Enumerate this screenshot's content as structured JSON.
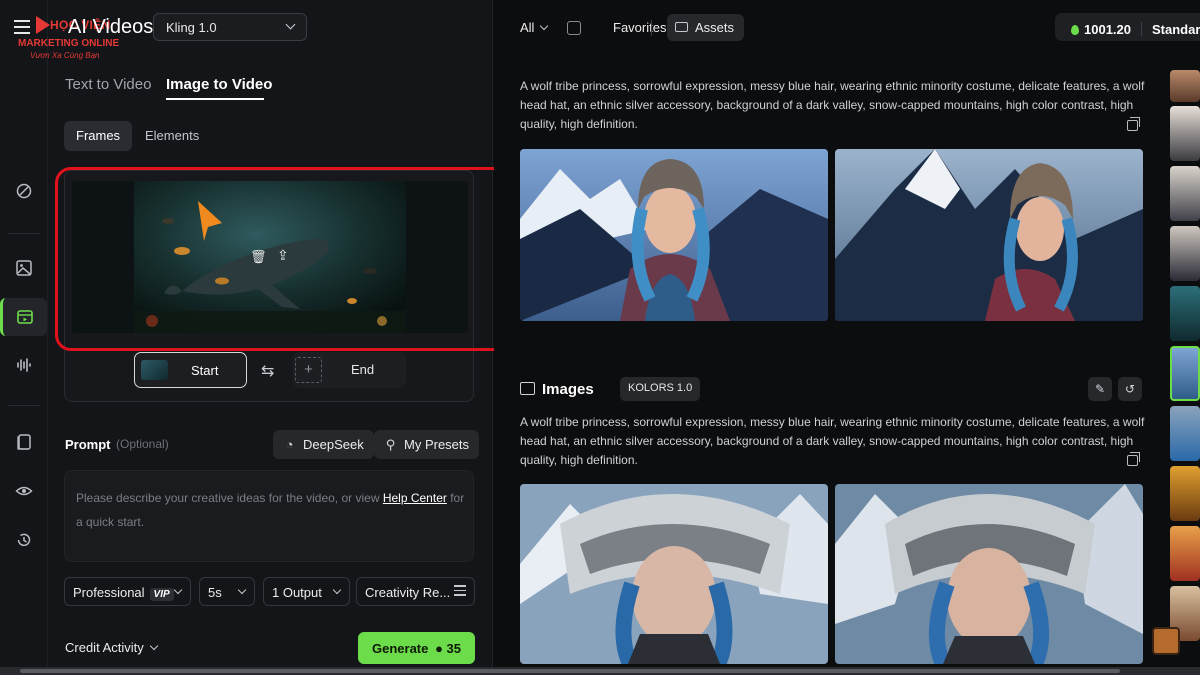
{
  "logo": {
    "brand": "HỌC VIỆN",
    "line1": "MARKETING ONLINE",
    "line2": "Vươn Xa Cùng Bạn"
  },
  "header": {
    "title": "AI Videos",
    "model": "Kling 1.0"
  },
  "mode_tabs": [
    "Text to Video",
    "Image to Video"
  ],
  "sub_tabs": [
    "Frames",
    "Elements"
  ],
  "frames": {
    "start_label": "Start",
    "end_label": "End",
    "swap_glyph": "⇆",
    "add_glyph": "+"
  },
  "prompt": {
    "label": "Prompt",
    "optional": "(Optional)",
    "deepseek": "DeepSeek",
    "presets": "My Presets",
    "placeholder_before": "Please describe your creative ideas for the video, or view ",
    "help_link": "Help Center",
    "placeholder_after": " for a quick start."
  },
  "options": {
    "mode": "Professional",
    "vip": "VIP",
    "duration": "5s",
    "outputs": "1 Output",
    "creativity": "Creativity Re..."
  },
  "footer": {
    "credit_activity": "Credit Activity",
    "generate": "Generate",
    "cost": "35"
  },
  "topbar": {
    "filter": "All",
    "favorites": "Favorites",
    "assets": "Assets",
    "credits": "1001.20",
    "plan": "Standard"
  },
  "results": [
    {
      "prompt": "A wolf tribe princess, sorrowful expression, messy blue hair, wearing ethnic minority costume, delicate features, a wolf head hat, an ethnic silver accessory, background of a dark valley, snow-capped mountains, high color contrast, high quality, high definition."
    },
    {
      "section": "Images",
      "model_tag": "KOLORS 1.0",
      "prompt": "A wolf tribe princess, sorrowful expression, messy blue hair, wearing ethnic minority costume, delicate features, a wolf head hat, an ethnic silver accessory, background of a dark valley, snow-capped mountains, high color contrast, high quality, high definition."
    }
  ],
  "colors": {
    "accent": "#6ddc4a",
    "highlight_ring": "#e0121e",
    "panel": "#141518",
    "background": "#0c0d0f"
  }
}
